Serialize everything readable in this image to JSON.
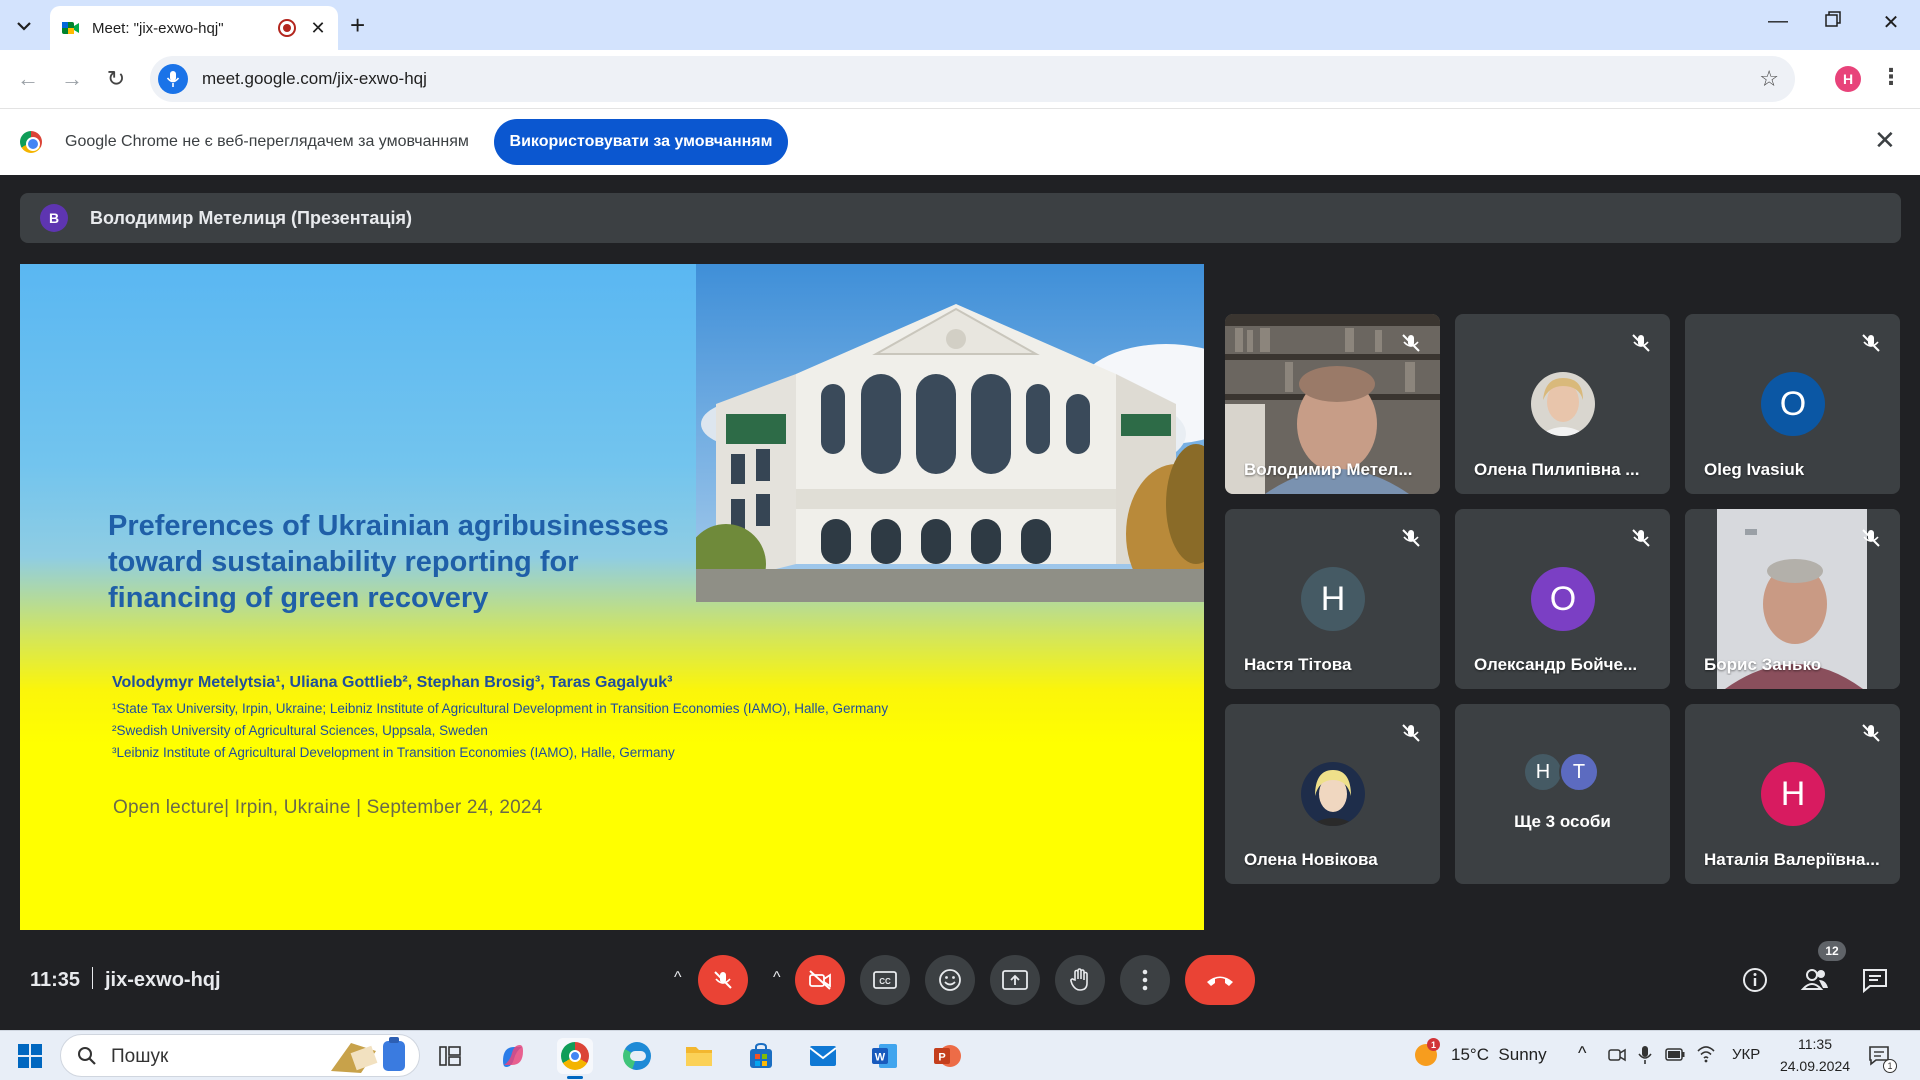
{
  "browser": {
    "tab_title": "Meet: \"jix-exwo-hqj\"",
    "url": "meet.google.com/jix-exwo-hqj",
    "profile_initial": "H",
    "infobar": {
      "text": "Google Chrome не є веб-переглядачем за умовчанням",
      "button": "Використовувати за умовчанням"
    }
  },
  "meet": {
    "presenter": {
      "initial": "В",
      "label": "Володимир Метелиця (Презентація)"
    },
    "slide": {
      "title": "Preferences of Ukrainian agribusinesses toward sustainability reporting for financing of green recovery",
      "authors": "Volodymyr Metelytsia¹, Uliana Gottlieb², Stephan Brosig³, Taras Gagalyuk³",
      "affiliations": [
        "¹State Tax University, Irpin, Ukraine; Leibniz Institute of Agricultural Development in Transition Economies (IAMO), Halle, Germany",
        "²Swedish University of Agricultural Sciences, Uppsala, Sweden",
        "³Leibniz Institute of Agricultural Development in Transition Economies (IAMO), Halle, Germany"
      ],
      "footer": "Open lecture| Irpin, Ukraine | September 24, 2024"
    },
    "participants": [
      {
        "name": "Володимир Метел...",
        "type": "video",
        "muted": true
      },
      {
        "name": "Олена Пилипівна ...",
        "type": "photo",
        "muted": true
      },
      {
        "name": "Oleg Ivasiuk",
        "type": "initial",
        "initial": "O",
        "color": "#0b57a4",
        "muted": true
      },
      {
        "name": "Настя Тітова",
        "type": "initial",
        "initial": "Н",
        "color": "#455a64",
        "muted": true
      },
      {
        "name": "Олександр Бойче...",
        "type": "initial",
        "initial": "О",
        "color": "#7b3fc4",
        "muted": true
      },
      {
        "name": "Борис Занько",
        "type": "video",
        "muted": true
      },
      {
        "name": "Олена Новікова",
        "type": "photo",
        "muted": true
      },
      {
        "name": "Наталія Валеріївна...",
        "type": "initial",
        "initial": "Н",
        "color": "#d81b60",
        "muted": true
      }
    ],
    "more": {
      "initials": [
        "Н",
        "Т"
      ],
      "colors": [
        "#455a64",
        "#5c6bc0"
      ],
      "label": "Ще 3 особи"
    },
    "time": "11:35",
    "meeting_code": "jix-exwo-hqj",
    "participant_count": "12"
  },
  "taskbar": {
    "search_placeholder": "Пошук",
    "weather": "15°C  Sunny",
    "weather_badge": "1",
    "language": "УКР",
    "clock_time": "11:35",
    "clock_date": "24.09.2024",
    "notif_count": "1"
  },
  "icons": [
    "chevron-down-icon",
    "meet-favicon",
    "recording-icon",
    "close-icon",
    "plus-icon",
    "minimize-icon",
    "restore-icon",
    "back-icon",
    "forward-icon",
    "reload-icon",
    "mic-icon",
    "star-icon",
    "kebab-menu-icon",
    "chrome-logo",
    "mic-off-icon",
    "camera-off-icon",
    "captions-icon",
    "emoji-icon",
    "present-icon",
    "raise-hand-icon",
    "more-options-icon",
    "hang-up-icon",
    "info-icon",
    "people-icon",
    "chat-icon",
    "windows-start-icon",
    "search-icon",
    "task-view-icon",
    "copilot-icon",
    "chrome-icon",
    "edge-icon",
    "file-explorer-icon",
    "store-icon",
    "mail-icon",
    "word-icon",
    "powerpoint-icon",
    "wifi-icon",
    "battery-icon",
    "notification-icon"
  ]
}
